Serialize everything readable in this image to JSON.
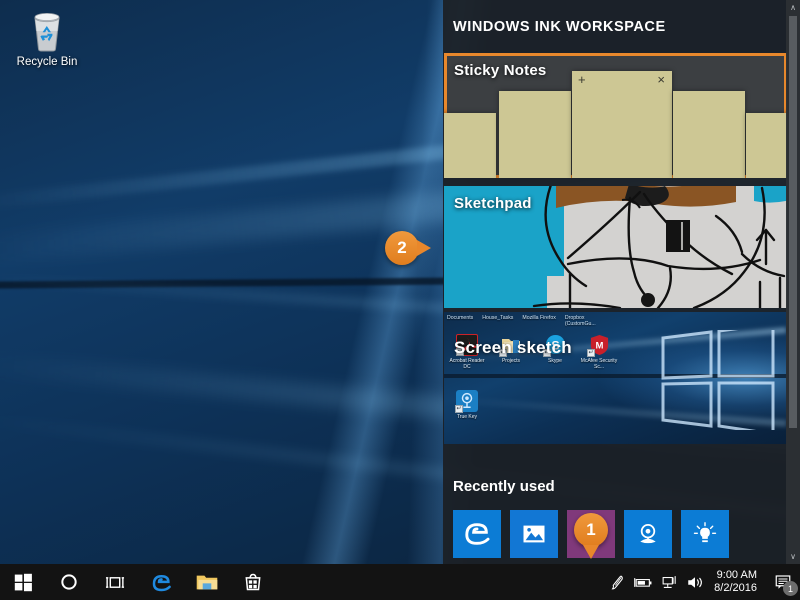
{
  "desktop": {
    "recycle_bin": {
      "label": "Recycle Bin",
      "icon": "recycle-bin-icon"
    }
  },
  "ink_workspace": {
    "title": "WINDOWS INK WORKSPACE",
    "accent_color": "#e8882c",
    "panel_bg": "#1c2025",
    "cards": [
      {
        "id": "sticky-notes",
        "label": "Sticky Notes",
        "highlighted": true,
        "note_color": "#cdc794",
        "buttons": {
          "add": "+",
          "close": "×"
        }
      },
      {
        "id": "sketchpad",
        "label": "Sketchpad",
        "highlighted": true,
        "ink_color": "#000000",
        "fill_color": "#1aa3c8"
      },
      {
        "id": "screen-sketch",
        "label": "Screen sketch",
        "highlighted": true
      }
    ],
    "screen_sketch": {
      "top_labels": [
        "Documents",
        "House_Tasks",
        "Mozilla Firefox",
        "Dropbox (CustomGu..."
      ],
      "icons": [
        {
          "name": "Acrobat Reader DC",
          "icon": "acrobat-reader-icon"
        },
        {
          "name": "Projects",
          "icon": "folder-icon"
        },
        {
          "name": "Skype",
          "icon": "skype-icon"
        },
        {
          "name": "McAfee Security Sc...",
          "icon": "mcafee-icon"
        },
        {
          "name": "True Key",
          "icon": "true-key-icon"
        }
      ]
    },
    "recently_used": {
      "label": "Recently used",
      "tiles": [
        {
          "icon": "edge-icon",
          "color": "#0c7cd5"
        },
        {
          "icon": "photos-icon",
          "color": "#1277d4"
        },
        {
          "icon": "onenote-icon",
          "color": "#80397b"
        },
        {
          "icon": "camera-icon",
          "color": "#0c7cd5"
        },
        {
          "icon": "tips-lightbulb-icon",
          "color": "#0c7cd5"
        }
      ]
    },
    "scrollbar": {
      "up": "∧",
      "down": "∨"
    }
  },
  "callouts": [
    {
      "number": "1",
      "target": "onenote-tile"
    },
    {
      "number": "2",
      "target": "sketchpad-card"
    }
  ],
  "taskbar": {
    "buttons": [
      {
        "icon": "start-windows-icon"
      },
      {
        "icon": "cortana-search-icon"
      },
      {
        "icon": "task-view-icon"
      },
      {
        "icon": "edge-icon"
      },
      {
        "icon": "file-explorer-icon"
      },
      {
        "icon": "microsoft-store-icon"
      }
    ],
    "tray": [
      {
        "icon": "pen-ink-workspace-icon"
      },
      {
        "icon": "battery-icon"
      },
      {
        "icon": "network-icon"
      },
      {
        "icon": "volume-icon"
      }
    ],
    "clock": {
      "time": "9:00 AM",
      "date": "8/2/2016"
    },
    "action_center": {
      "icon": "action-center-icon",
      "badge": "1"
    }
  }
}
